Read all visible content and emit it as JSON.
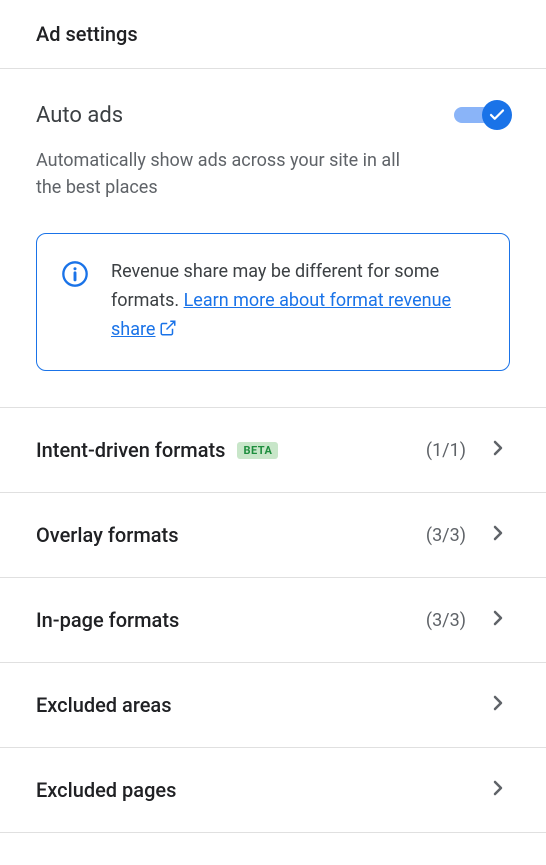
{
  "header": {
    "title": "Ad settings"
  },
  "autoAds": {
    "title": "Auto ads",
    "enabled": true,
    "description": "Automatically show ads across your site in all the best places",
    "info": {
      "text": "Revenue share may be different for some formats. ",
      "linkText": "Learn more about format revenue share"
    }
  },
  "sections": [
    {
      "label": "Intent-driven formats",
      "badge": "BETA",
      "count": "(1/1)"
    },
    {
      "label": "Overlay formats",
      "badge": "",
      "count": "(3/3)"
    },
    {
      "label": "In-page formats",
      "badge": "",
      "count": "(3/3)"
    },
    {
      "label": "Excluded areas",
      "badge": "",
      "count": ""
    },
    {
      "label": "Excluded pages",
      "badge": "",
      "count": ""
    }
  ],
  "colors": {
    "primary": "#1a73e8",
    "textSecondary": "#5f6368",
    "border": "#e0e0e0"
  }
}
